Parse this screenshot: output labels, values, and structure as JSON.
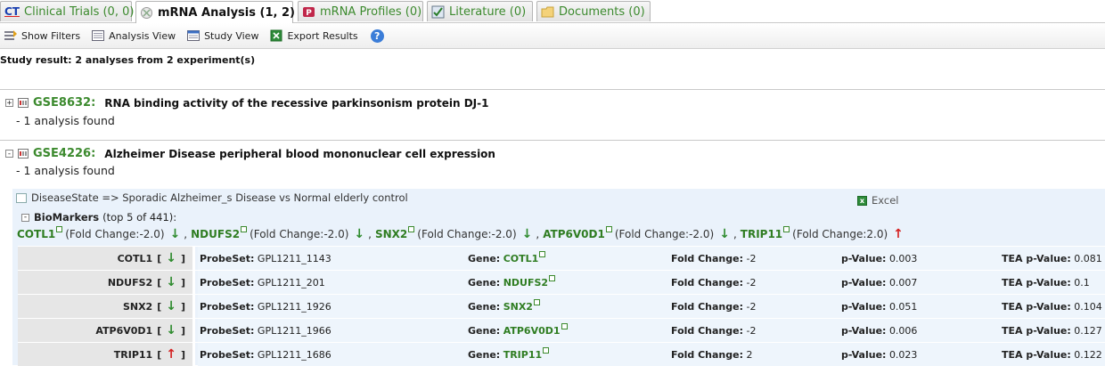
{
  "tabs": [
    {
      "label": "Clinical Trials (0, 0)",
      "icon": "ct-icon",
      "active": false
    },
    {
      "label": "mRNA Analysis (1, 2)",
      "icon": "mrna-analysis-icon",
      "active": true
    },
    {
      "label": "mRNA Profiles (0)",
      "icon": "mrna-profiles-icon",
      "active": false
    },
    {
      "label": "Literature (0)",
      "icon": "literature-icon",
      "active": false
    },
    {
      "label": "Documents (0)",
      "icon": "documents-icon",
      "active": false
    }
  ],
  "tab_ct_glyph": "CT",
  "toolbar": {
    "show_filters": "Show Filters",
    "analysis_view": "Analysis View",
    "study_view": "Study View",
    "export_results": "Export Results",
    "help": "?"
  },
  "summary": "Study result:  2 analyses  from 2 experiment(s)",
  "experiments": [
    {
      "id": "GSE8632:",
      "title": "RNA binding activity of the recessive parkinsonism protein DJ-1",
      "found": "- 1 analysis found",
      "expand": "+"
    },
    {
      "id": "GSE4226:",
      "title": "Alzheimer Disease peripheral blood mononuclear cell expression",
      "found": "- 1 analysis found",
      "expand": "-"
    }
  ],
  "analysis": {
    "disease_state": "DiseaseState => Sporadic Alzheimer_s Disease vs Normal elderly control",
    "excel": "Excel",
    "excel_glyph": "x",
    "biomarkers_label": "BioMarkers",
    "biomarkers_count": "(top 5 of 441):",
    "expand": "-",
    "biomarkers": [
      {
        "gene": "COTL1",
        "fc": "(Fold Change:-2.0)",
        "dir": "↓"
      },
      {
        "gene": "NDUFS2",
        "fc": "(Fold Change:-2.0)",
        "dir": "↓"
      },
      {
        "gene": "SNX2",
        "fc": "(Fold Change:-2.0)",
        "dir": "↓"
      },
      {
        "gene": "ATP6V0D1",
        "fc": "(Fold Change:-2.0)",
        "dir": "↓"
      },
      {
        "gene": "TRIP11",
        "fc": "(Fold Change:2.0)",
        "dir": "↑"
      }
    ],
    "sep": ",",
    "field_labels": {
      "probeset": "ProbeSet:",
      "gene": "Gene:",
      "fold": "Fold Change:",
      "pval": "p-Value:",
      "tea": "TEA p-Value:"
    },
    "rows": [
      {
        "name": "COTL1",
        "dir": "↓",
        "probeset": "GPL1211_1143",
        "gene": "COTL1",
        "fold": "-2",
        "pval": "0.003",
        "tea": "0.081"
      },
      {
        "name": "NDUFS2",
        "dir": "↓",
        "probeset": "GPL1211_201",
        "gene": "NDUFS2",
        "fold": "-2",
        "pval": "0.007",
        "tea": "0.1"
      },
      {
        "name": "SNX2",
        "dir": "↓",
        "probeset": "GPL1211_1926",
        "gene": "SNX2",
        "fold": "-2",
        "pval": "0.051",
        "tea": "0.104"
      },
      {
        "name": "ATP6V0D1",
        "dir": "↓",
        "probeset": "GPL1211_1966",
        "gene": "ATP6V0D1",
        "fold": "-2",
        "pval": "0.006",
        "tea": "0.127"
      },
      {
        "name": "TRIP11",
        "dir": "↑",
        "probeset": "GPL1211_1686",
        "gene": "TRIP11",
        "fold": "2",
        "pval": "0.023",
        "tea": "0.122"
      }
    ],
    "bracket_open": "[",
    "bracket_close": "]"
  }
}
